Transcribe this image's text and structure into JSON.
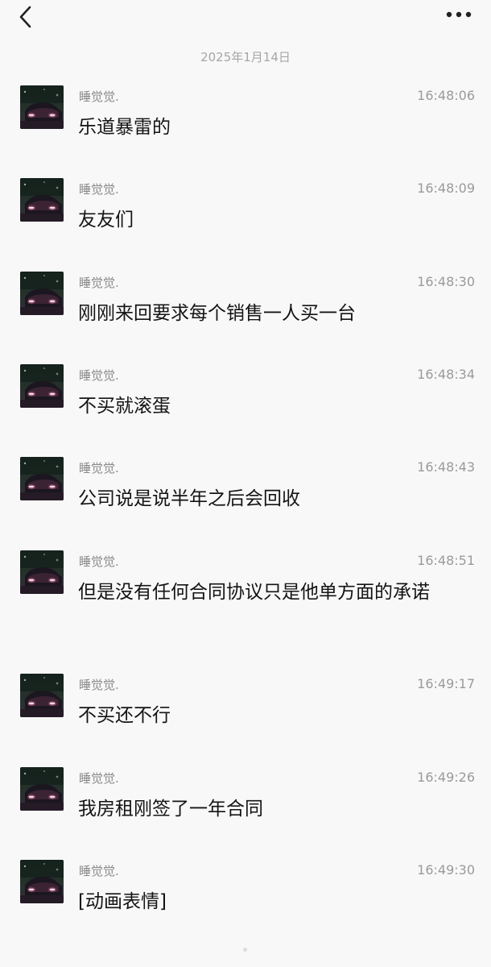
{
  "header": {
    "back_icon": "chevron-left-icon",
    "more_icon": "more-dots-icon"
  },
  "date_divider": "2025年1月14日",
  "messages": [
    {
      "sender": "睡觉觉.",
      "time": "16:48:06",
      "text": "乐道暴雷的"
    },
    {
      "sender": "睡觉觉.",
      "time": "16:48:09",
      "text": "友友们"
    },
    {
      "sender": "睡觉觉.",
      "time": "16:48:30",
      "text": "刚刚来回要求每个销售一人买一台"
    },
    {
      "sender": "睡觉觉.",
      "time": "16:48:34",
      "text": "不买就滚蛋"
    },
    {
      "sender": "睡觉觉.",
      "time": "16:48:43",
      "text": "公司说是说半年之后会回收"
    },
    {
      "sender": "睡觉觉.",
      "time": "16:48:51",
      "text": "但是没有任何合同协议只是他单方面的承诺"
    },
    {
      "sender": "睡觉觉.",
      "time": "16:49:17",
      "text": "不买还不行"
    },
    {
      "sender": "睡觉觉.",
      "time": "16:49:26",
      "text": "我房租刚签了一年合同"
    },
    {
      "sender": "睡觉觉.",
      "time": "16:49:30",
      "text": "[动画表情]"
    }
  ]
}
